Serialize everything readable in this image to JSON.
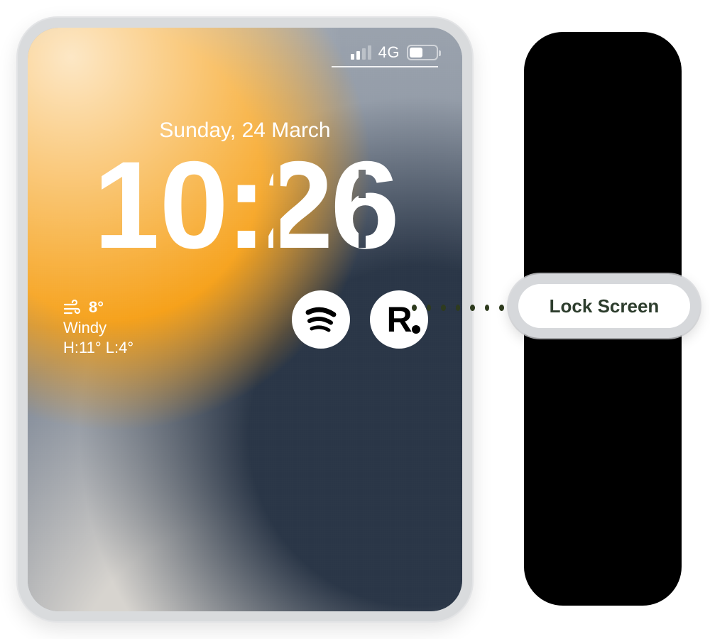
{
  "status_bar": {
    "network_label": "4G",
    "signal_active_bars": 2,
    "signal_total_bars": 4
  },
  "lock_screen": {
    "date": "Sunday, 24 March",
    "time": "10:26"
  },
  "weather": {
    "temperature": "8°",
    "condition": "Windy",
    "high_low": "H:11° L:4°"
  },
  "widgets": {
    "spotify_name": "spotify",
    "r_app_letter": "R"
  },
  "callout": {
    "label": "Lock Screen"
  }
}
